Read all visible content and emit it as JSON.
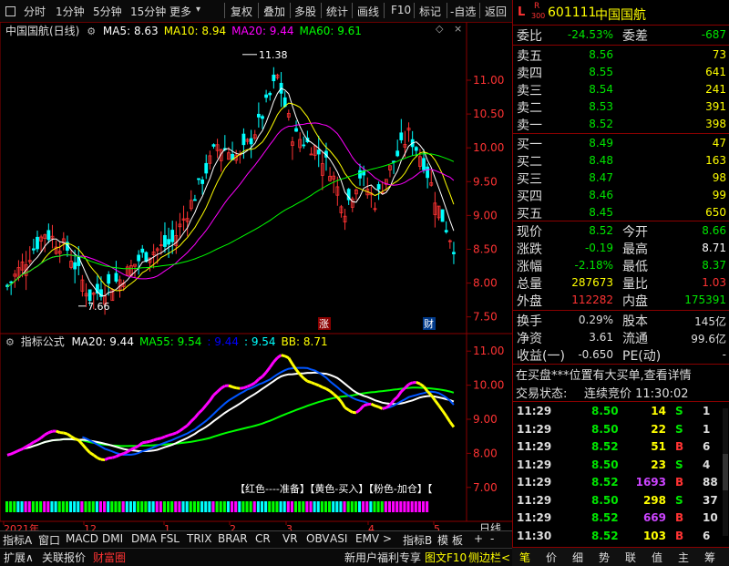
{
  "toolbar": {
    "periods": [
      "分时",
      "1分钟",
      "5分钟",
      "15分钟",
      "更多"
    ],
    "tools": [
      "复权",
      "叠加",
      "多股",
      "统计",
      "画线",
      "F10",
      "标记",
      "-自选",
      "返回"
    ]
  },
  "stock": {
    "code": "601111",
    "name": "中国国航",
    "prefix_l": "L",
    "prefix_r": "R",
    "prefix_num": "300"
  },
  "main_chart": {
    "title": "中国国航(日线)",
    "ma_labels": [
      {
        "text": "MA5: 8.63",
        "color": "#ffffff"
      },
      {
        "text": "MA10: 8.94",
        "color": "#ffff00"
      },
      {
        "text": "MA20: 9.44",
        "color": "#ff00ff"
      },
      {
        "text": "MA60: 9.61",
        "color": "#00ff00"
      }
    ],
    "ylabels": [
      "11.00",
      "10.50",
      "10.00",
      "9.50",
      "9.00",
      "8.50",
      "8.00",
      "7.50"
    ],
    "yrange": [
      7.28,
      11.62
    ],
    "high_mark": "11.38",
    "low_mark": "7.66",
    "badge_zhang": "涨",
    "badge_cai": "财"
  },
  "indicator": {
    "title": "指标公式",
    "labels": [
      {
        "text": "MA20: 9.44",
        "color": "#ffffff"
      },
      {
        "text": "MA55: 9.54",
        "color": "#00ff00"
      },
      {
        "text": ": 9.44",
        "color": "#0000ff"
      },
      {
        "text": ": 9.54",
        "color": "#00ffff"
      },
      {
        "text": "BB: 8.71",
        "color": "#ffff00"
      }
    ],
    "ylabels": [
      "11.00",
      "10.00",
      "9.00",
      "8.00",
      "7.00"
    ],
    "yrange": [
      6.7,
      11.3
    ],
    "legend": "【红色----准备】【黄色-买入】【粉色-加仓】【"
  },
  "xaxis": {
    "labels": [
      "2021年",
      "12",
      "1",
      "2",
      "3",
      "4",
      "5"
    ],
    "mode": "日线"
  },
  "indicator_tabs": [
    "指标A",
    "窗口",
    "MACD",
    "DMI",
    "DMA",
    "FSL",
    "TRIX",
    "BRAR",
    "CR",
    "VR",
    "OBV",
    "ASI",
    "EMV",
    ">",
    "指标B",
    "模",
    "板",
    "+",
    "-"
  ],
  "bottom_tabs": [
    "扩展∧",
    "关联报价",
    "财富圈"
  ],
  "bottom_right_text": [
    "新用户福利专享",
    "图文F10",
    "侧边栏<"
  ],
  "quote": {
    "weibi_label": "委比",
    "weibi": "-24.53%",
    "weicha_label": "委差",
    "weicha": "-687",
    "sell": [
      {
        "label": "卖五",
        "price": "8.56",
        "vol": "73"
      },
      {
        "label": "卖四",
        "price": "8.55",
        "vol": "641"
      },
      {
        "label": "卖三",
        "price": "8.54",
        "vol": "241"
      },
      {
        "label": "卖二",
        "price": "8.53",
        "vol": "391"
      },
      {
        "label": "卖一",
        "price": "8.52",
        "vol": "398"
      }
    ],
    "buy": [
      {
        "label": "买一",
        "price": "8.49",
        "vol": "47"
      },
      {
        "label": "买二",
        "price": "8.48",
        "vol": "163"
      },
      {
        "label": "买三",
        "price": "8.47",
        "vol": "98"
      },
      {
        "label": "买四",
        "price": "8.46",
        "vol": "99"
      },
      {
        "label": "买五",
        "price": "8.45",
        "vol": "650"
      }
    ],
    "stats": [
      {
        "l1": "现价",
        "v1": "8.52",
        "c1": "#00e600",
        "l2": "今开",
        "v2": "8.66",
        "c2": "#00e600"
      },
      {
        "l1": "涨跌",
        "v1": "-0.19",
        "c1": "#00e600",
        "l2": "最高",
        "v2": "8.71",
        "c2": "#ffffff"
      },
      {
        "l1": "涨幅",
        "v1": "-2.18%",
        "c1": "#00e600",
        "l2": "最低",
        "v2": "8.37",
        "c2": "#00e600"
      },
      {
        "l1": "总量",
        "v1": "287673",
        "c1": "#ffff00",
        "l2": "量比",
        "v2": "1.03",
        "c2": "#ff3333"
      },
      {
        "l1": "外盘",
        "v1": "112282",
        "c1": "#ff3333",
        "l2": "内盘",
        "v2": "175391",
        "c2": "#00e600"
      }
    ],
    "stats2": [
      {
        "l1": "换手",
        "v1": "0.29%",
        "l2": "股本",
        "v2": "145亿"
      },
      {
        "l1": "净资",
        "v1": "3.61",
        "l2": "流通",
        "v2": "99.6亿"
      },
      {
        "l1": "收益(一)",
        "v1": "-0.650",
        "l2": "PE(动)",
        "v2": "-"
      }
    ],
    "notice": "在买盘***位置有大买单,查看详情",
    "status_label": "交易状态:",
    "status": "连续竞价 11:30:02",
    "ticks": [
      {
        "t": "11:29",
        "p": "8.50",
        "v": "14",
        "bs": "S",
        "n": "1"
      },
      {
        "t": "11:29",
        "p": "8.50",
        "v": "22",
        "bs": "S",
        "n": "1"
      },
      {
        "t": "11:29",
        "p": "8.52",
        "v": "51",
        "bs": "B",
        "n": "6"
      },
      {
        "t": "11:29",
        "p": "8.50",
        "v": "23",
        "bs": "S",
        "n": "4"
      },
      {
        "t": "11:29",
        "p": "8.52",
        "v": "1693",
        "bs": "B",
        "n": "88"
      },
      {
        "t": "11:29",
        "p": "8.50",
        "v": "298",
        "bs": "S",
        "n": "37"
      },
      {
        "t": "11:29",
        "p": "8.52",
        "v": "669",
        "bs": "B",
        "n": "10"
      },
      {
        "t": "11:30",
        "p": "8.52",
        "v": "103",
        "bs": "B",
        "n": "6"
      }
    ],
    "tabs": [
      "笔",
      "价",
      "细",
      "势",
      "联",
      "值",
      "主",
      "筹"
    ]
  },
  "colors": {
    "up": "#ff3333",
    "down": "#00e600",
    "cyan": "#00ffff",
    "axis": "#8a0000",
    "yellow": "#ffff00",
    "magenta": "#ff00ff"
  }
}
